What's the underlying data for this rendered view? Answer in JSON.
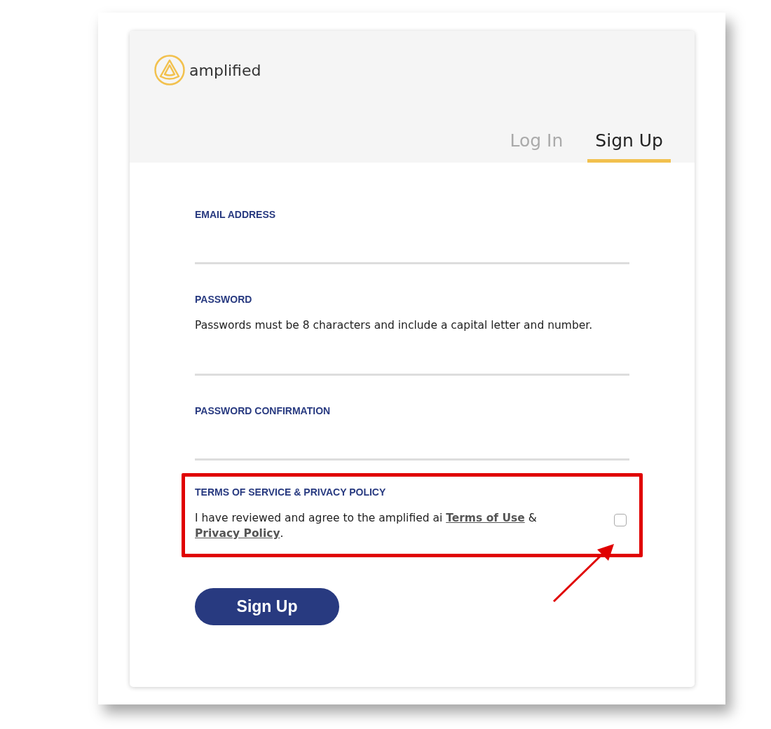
{
  "brand": {
    "name": "amplified"
  },
  "tabs": [
    {
      "label": "Log In",
      "selected": false
    },
    {
      "label": "Sign Up",
      "selected": true
    }
  ],
  "fields": [
    {
      "label": "EMAIL ADDRESS"
    },
    {
      "label": "PASSWORD",
      "hint": "Passwords must be 8 characters and include a capital letter and number."
    },
    {
      "label": "PASSWORD CONFIRMATION"
    }
  ],
  "terms": {
    "heading": "TERMS OF SERVICE & PRIVACY POLICY",
    "text_before": "I have reviewed and agree to the amplified ai ",
    "links": [
      "Terms of Use",
      "Privacy Policy"
    ],
    "separator": " & ",
    "text_after": ".",
    "checked": false
  },
  "annotation": {
    "highlight": true,
    "arrow": true
  },
  "submit": {
    "label": "Sign Up"
  }
}
